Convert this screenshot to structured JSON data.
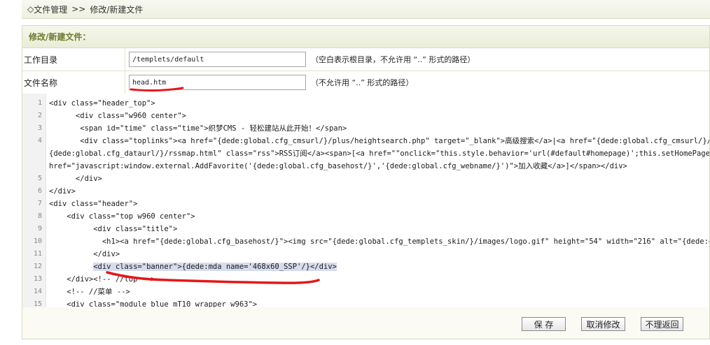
{
  "breadcrumb": {
    "prefix": "◇",
    "root": "文件管理",
    "separator": ">>",
    "current": "修改/新建文件"
  },
  "panel": {
    "title": "修改/新建文件："
  },
  "form": {
    "dir_label": "工作目录",
    "dir_value": "/templets/default",
    "dir_hint": "（空白表示根目录，不允许用 “..” 形式的路径）",
    "file_label": "文件名称",
    "file_value": "head.htm",
    "file_hint": "（不允许用 “..” 形式的路径）"
  },
  "editor": {
    "lines": [
      {
        "n": "1",
        "text": "<div class=\"header_top\">"
      },
      {
        "n": "2",
        "text": "      <div class=\"w960 center\">"
      },
      {
        "n": "3",
        "text": "       <span id=\"time\" class=\"time\">织梦CMS - 轻松建站从此开始！</span>"
      },
      {
        "n": "4",
        "text": "       <div class=\"toplinks\"><a href=\"{dede:global.cfg_cmsurl/}/plus/heightsearch.php\" target=\"_blank\">高级搜索</a>|<a href=\"{dede:global.cfg_cmsurl/}/data/sitemap.html\" target=\"_blank\">网站地图</a>|<a href="
      },
      {
        "n": "",
        "text": "{dede:global.cfg_dataurl/}/rssmap.html\" class=\"rss\">RSS订阅</a><span>[<a href=\"\"onclick=\"this.style.behavior='url(#default#homepage)';this.setHomePage('{dede:global.cfg_basehost/}');\">设为首页</a>] [<a"
      },
      {
        "n": "",
        "text": "href=\"javascript:window.external.AddFavorite('{dede:global.cfg_basehost/}','{dede:global.cfg_webname/}')\">加入收藏</a>]</span></div>"
      },
      {
        "n": "5",
        "text": "      </div>"
      },
      {
        "n": "6",
        "text": "</div>"
      },
      {
        "n": "7",
        "text": "<div class=\"header\">"
      },
      {
        "n": "8",
        "text": "    <div class=\"top w960 center\">"
      },
      {
        "n": "9",
        "text": "          <div class=\"title\">"
      },
      {
        "n": "10",
        "text": "            <h1><a href=\"{dede:global.cfg_basehost/}\"><img src=\"{dede:global.cfg_templets_skin/}/images/logo.gif\" height=\"54\" width=\"216\" alt=\"{dede:global.cfg_webname/}\"/></a></h1>"
      },
      {
        "n": "11",
        "text": "          </div>"
      },
      {
        "n": "12",
        "text": "          <div class=\"banner\">{dede:mda name='468x60_SSP'/}</div>"
      },
      {
        "n": "13",
        "text": "    </div><!-- //top -->"
      },
      {
        "n": "14",
        "text": "    <!-- //菜单 -->"
      },
      {
        "n": "15",
        "text": "    <div class=\"module blue mT10 wrapper w963\">"
      }
    ]
  },
  "buttons": {
    "save": "保 存",
    "cancel": "取消修改",
    "back": "不理返回"
  },
  "colors": {
    "annotation": "#e5171b",
    "panel_title": "#6b7a2e"
  }
}
